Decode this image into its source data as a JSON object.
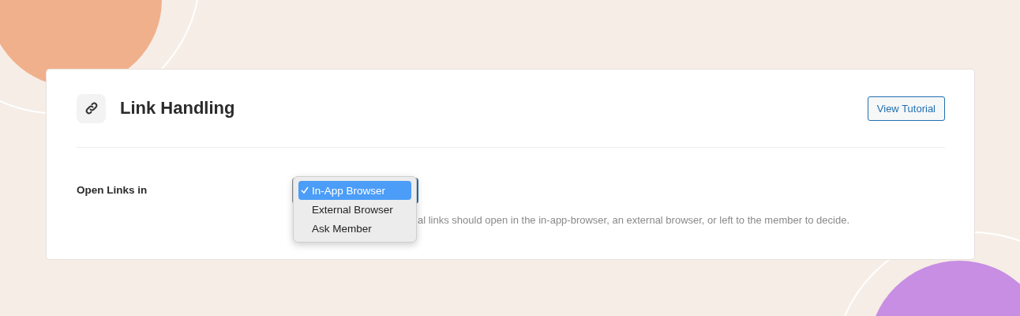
{
  "card": {
    "title": "Link Handling",
    "button": "View Tutorial"
  },
  "setting": {
    "label": "Open Links in",
    "help": "al links should open in the in-app-browser, an external browser, or left to the member to decide.",
    "options": [
      {
        "label": "In-App Browser",
        "selected": true
      },
      {
        "label": "External Browser",
        "selected": false
      },
      {
        "label": "Ask Member",
        "selected": false
      }
    ]
  }
}
